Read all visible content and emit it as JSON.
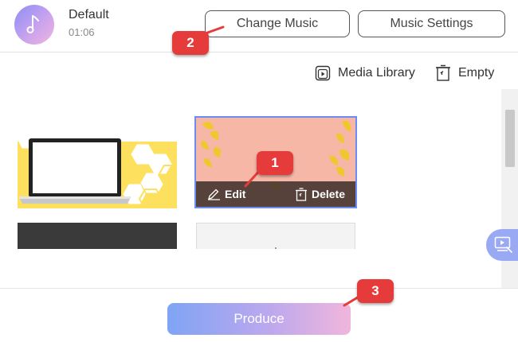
{
  "header": {
    "track_name": "Default",
    "track_time": "01:06",
    "change_music_label": "Change Music",
    "music_settings_label": "Music Settings",
    "avatar_icon": "music-note-icon"
  },
  "media_bar": {
    "media_library_label": "Media Library",
    "empty_label": "Empty"
  },
  "clip_toolbar": {
    "edit_label": "Edit",
    "delete_label": "Delete"
  },
  "footer": {
    "produce_label": "Produce"
  },
  "callouts": [
    "1",
    "2",
    "3"
  ],
  "colors": {
    "selected_border": "#6c8cf5",
    "callout_red": "#e53b3b",
    "produce_gradient_start": "#7fa4f4",
    "produce_gradient_end": "#f0b6dc"
  }
}
